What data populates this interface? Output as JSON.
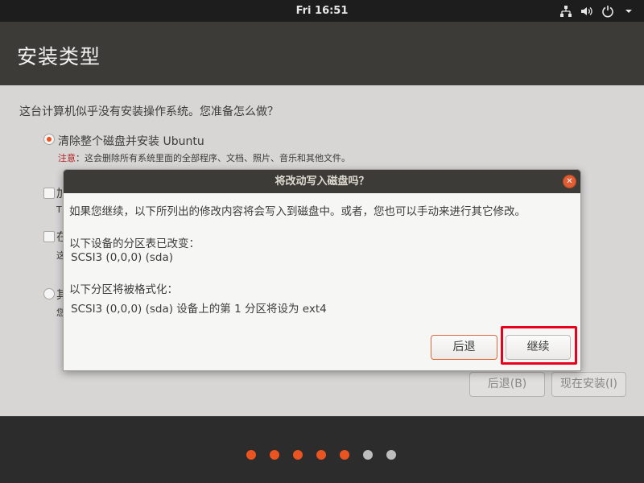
{
  "topbar": {
    "clock": "Fri 16:51",
    "icons": [
      "network-icon",
      "volume-icon",
      "power-icon",
      "chevron-down-icon"
    ]
  },
  "window": {
    "title": "安装类型"
  },
  "installer": {
    "question": "这台计算机似乎没有安装操作系统。您准备怎么做？",
    "option1_label": "清除整个磁盘并安装 Ubuntu",
    "option1_warning_prefix": "注意",
    "option1_warning_text": "：这会删除所有系统里面的全部程序、文档、照片、音乐和其他文件。",
    "peek2": "加",
    "peek2b": "T",
    "peek3": "在",
    "peek3b": "这",
    "peek4": "其",
    "peek4b": "您",
    "back_button": "后退(B)",
    "install_button": "现在安装(I)"
  },
  "dialog": {
    "title": "将改动写入磁盘吗？",
    "intro": "如果您继续，以下所列出的修改内容将会写入到磁盘中。或者，您也可以手动来进行其它修改。",
    "partition_table_heading": "以下设备的分区表已改变：",
    "partition_table_device": "SCSI3 (0,0,0) (sda)",
    "format_heading": "以下分区将被格式化：",
    "format_detail": "SCSI3 (0,0,0) (sda) 设备上的第 1 分区将设为 ext4",
    "back_button": "后退",
    "continue_button": "继续"
  },
  "progress": {
    "total_steps": 7,
    "completed_steps": 5
  },
  "colors": {
    "accent": "#e95420",
    "highlight": "#e8001c",
    "dot_done": "#e95420",
    "dot_todo": "#bdbdbd"
  }
}
